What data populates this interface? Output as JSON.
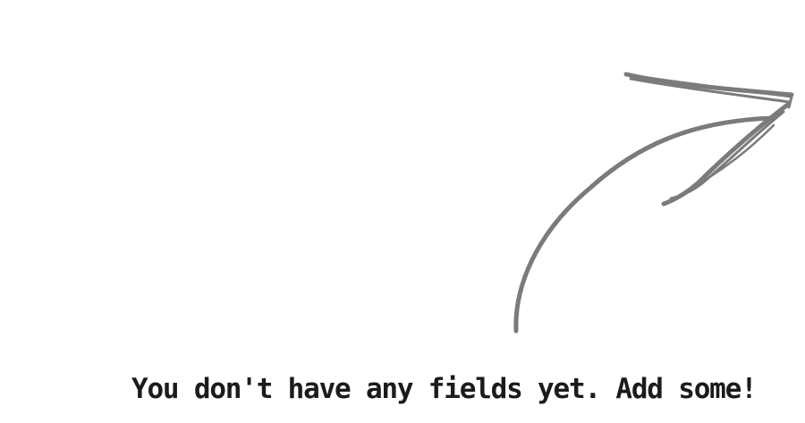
{
  "empty_state": {
    "message": "You don't have any fields yet. Add some!",
    "arrow_icon": "hand-drawn-arrow-icon",
    "arrow_color": "#7b7b7b",
    "text_color": "#1b1b1b",
    "background_color": "#ffffff"
  }
}
